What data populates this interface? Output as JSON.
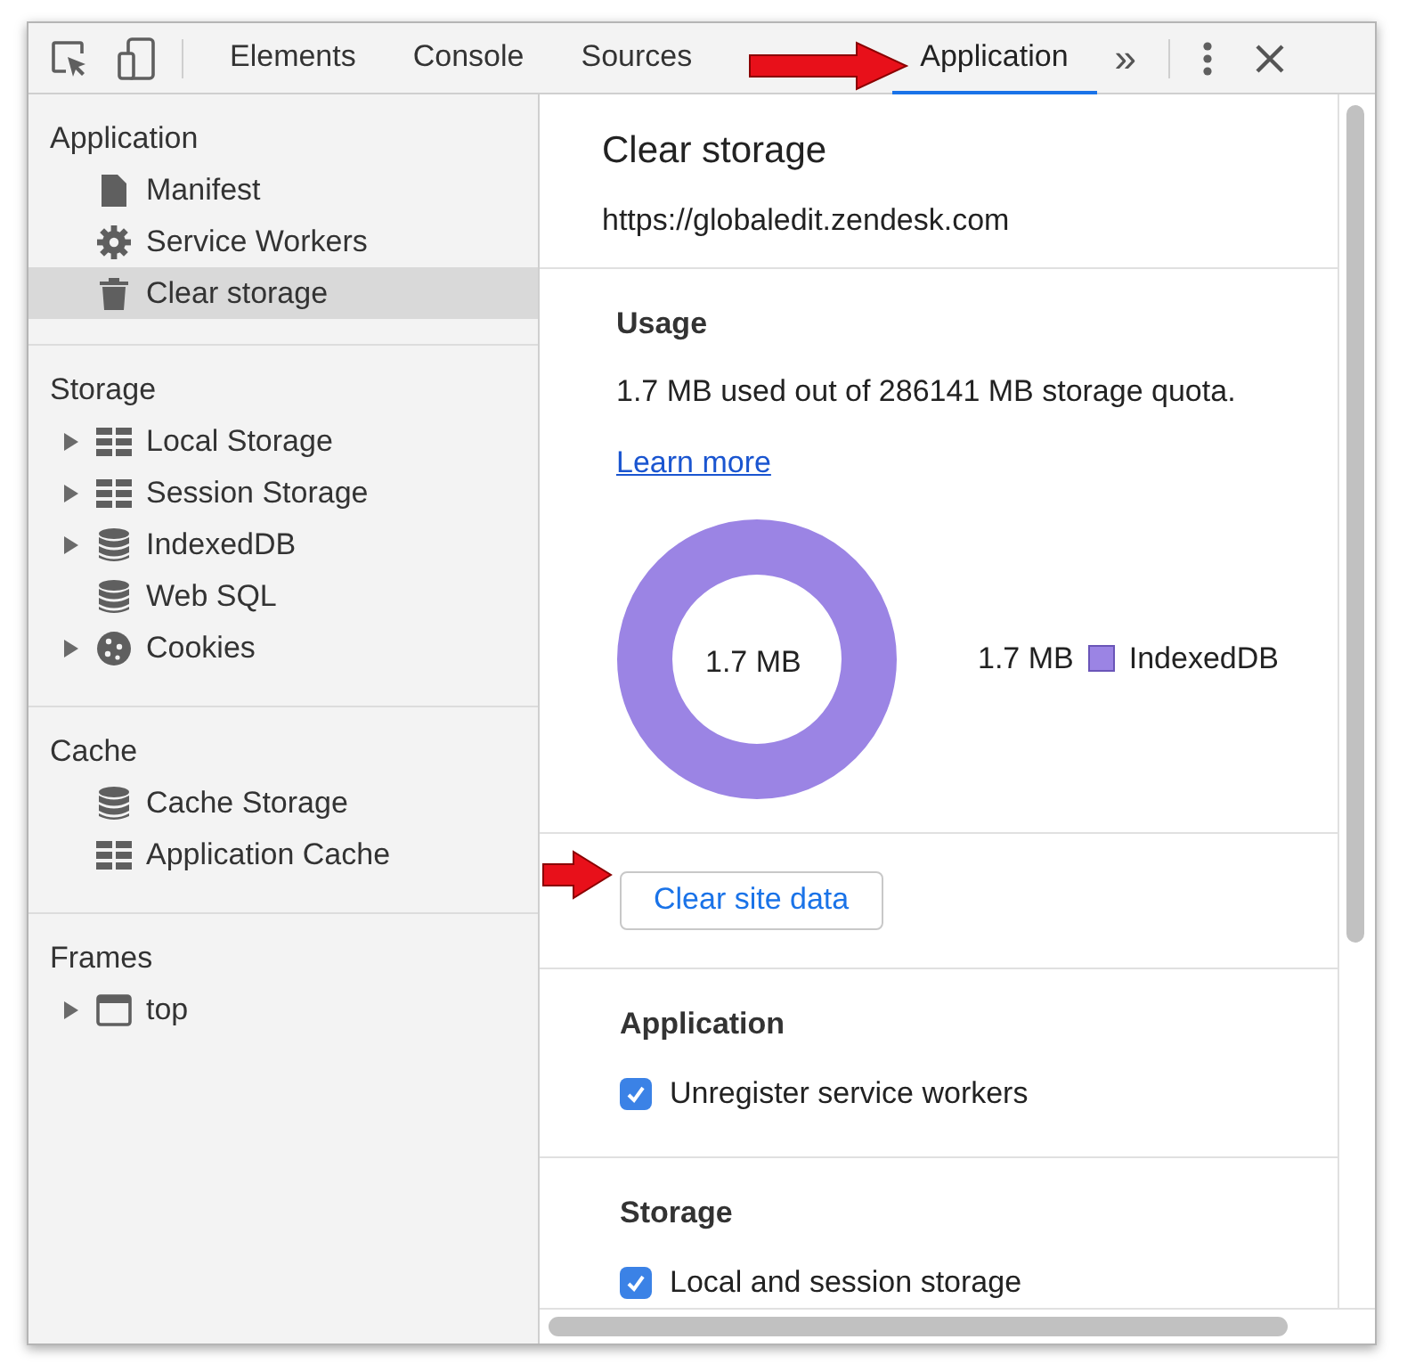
{
  "toolbar": {
    "tabs": [
      {
        "label": "Elements",
        "selected": false
      },
      {
        "label": "Console",
        "selected": false
      },
      {
        "label": "Sources",
        "selected": false
      },
      {
        "label": "Application",
        "selected": true
      }
    ],
    "more": "»"
  },
  "sidebar": {
    "sections": [
      {
        "title": "Application",
        "items": [
          {
            "label": "Manifest",
            "kind": "file",
            "expandable": false,
            "selected": false
          },
          {
            "label": "Service Workers",
            "kind": "gear",
            "expandable": false,
            "selected": false
          },
          {
            "label": "Clear storage",
            "kind": "trash",
            "expandable": false,
            "selected": true
          }
        ]
      },
      {
        "title": "Storage",
        "items": [
          {
            "label": "Local Storage",
            "kind": "grid",
            "expandable": true,
            "selected": false
          },
          {
            "label": "Session Storage",
            "kind": "grid",
            "expandable": true,
            "selected": false
          },
          {
            "label": "IndexedDB",
            "kind": "db",
            "expandable": true,
            "selected": false
          },
          {
            "label": "Web SQL",
            "kind": "db",
            "expandable": false,
            "selected": false
          },
          {
            "label": "Cookies",
            "kind": "cookie",
            "expandable": true,
            "selected": false
          }
        ]
      },
      {
        "title": "Cache",
        "items": [
          {
            "label": "Cache Storage",
            "kind": "db",
            "expandable": false,
            "selected": false
          },
          {
            "label": "Application Cache",
            "kind": "grid",
            "expandable": false,
            "selected": false
          }
        ]
      },
      {
        "title": "Frames",
        "items": [
          {
            "label": "top",
            "kind": "frame",
            "expandable": true,
            "selected": false
          }
        ]
      }
    ]
  },
  "main": {
    "title": "Clear storage",
    "url": "https://globaledit.zendesk.com",
    "usage": {
      "heading": "Usage",
      "text": "1.7 MB used out of 286141 MB storage quota.",
      "link": "Learn more",
      "center_label": "1.7 MB",
      "legend": [
        {
          "value": "1.7 MB",
          "label": "IndexedDB",
          "color": "#9b84e4"
        }
      ]
    },
    "button": "Clear site data",
    "groups": [
      {
        "heading": "Application",
        "options": [
          {
            "label": "Unregister service workers",
            "checked": true
          }
        ]
      },
      {
        "heading": "Storage",
        "options": [
          {
            "label": "Local and session storage",
            "checked": true
          }
        ]
      }
    ]
  }
}
